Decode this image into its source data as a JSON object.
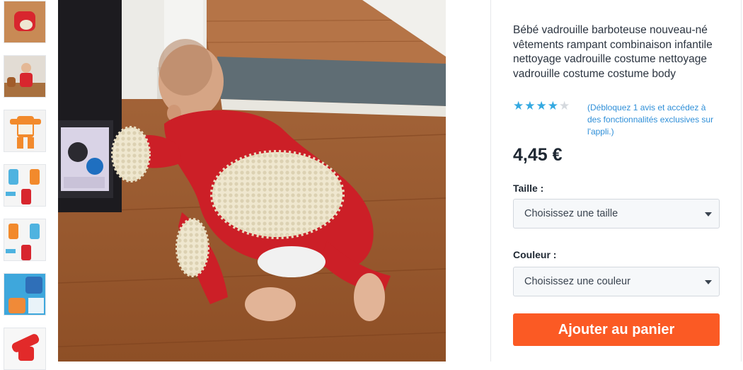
{
  "product": {
    "title": "Bébé vadrouille barboteuse nouveau-né vêtements rampant combinaison infantile nettoyage vadrouille costume nettoyage vadrouille costume costume body",
    "rating": {
      "filled": 4,
      "total": 5
    },
    "review_note": "(Débloquez 1 avis et accédez à des fonctionnalités exclusives sur l'appli.)",
    "price": "4,45 €"
  },
  "options": {
    "size_label": "Taille :",
    "size_placeholder": "Choisissez une taille",
    "color_label": "Couleur :",
    "color_placeholder": "Choisissez une couleur"
  },
  "actions": {
    "add_to_cart": "Ajouter au panier"
  },
  "colors": {
    "accent": "#fb5a24",
    "star": "#34a9e1",
    "link": "#2f8fd8"
  },
  "gallery": {
    "thumbnail_count": 7
  }
}
